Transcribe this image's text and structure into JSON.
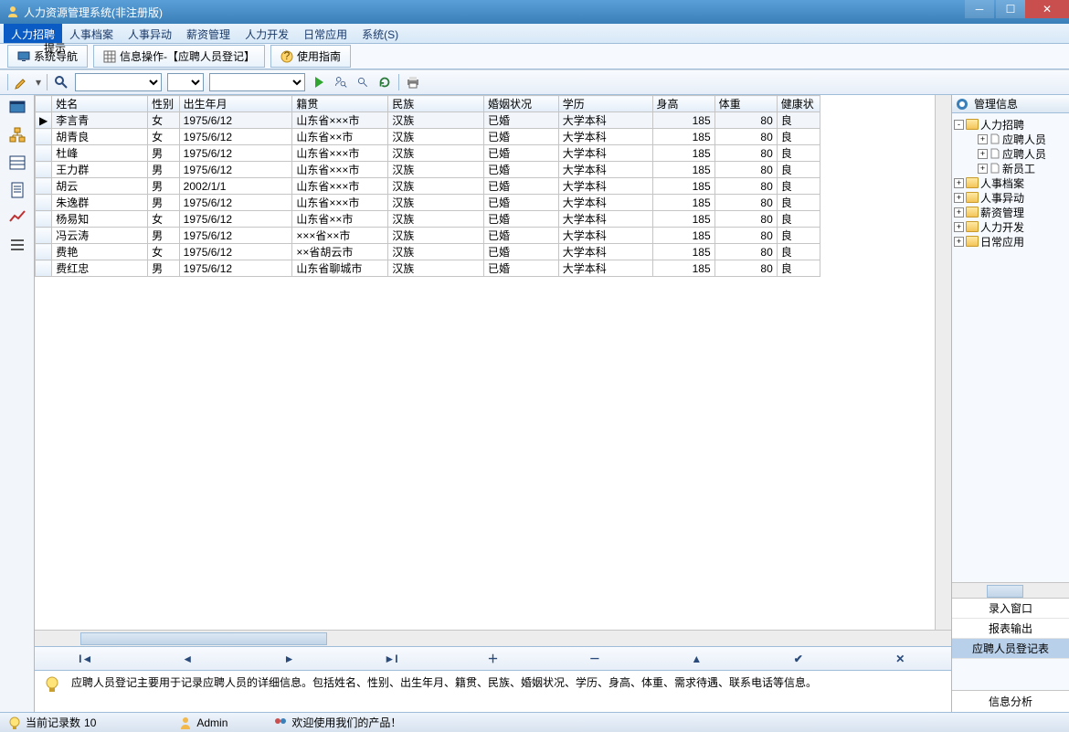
{
  "window": {
    "title": "人力资源管理系统(非注册版)"
  },
  "menus": [
    "人力招聘",
    "人事档案",
    "人事异动",
    "薪资管理",
    "人力开发",
    "日常应用",
    "系统(S)"
  ],
  "active_menu": 0,
  "tabs": {
    "nav": "系统导航",
    "info_op": "信息操作-【应聘人员登记】",
    "guide": "使用指南"
  },
  "grid": {
    "columns": [
      "姓名",
      "性别",
      "出生年月",
      "籍贯",
      "民族",
      "婚姻状况",
      "学历",
      "身高",
      "体重",
      "健康状"
    ],
    "rows": [
      {
        "name": "李言青",
        "sex": "女",
        "dob": "1975/6/12",
        "origin": "山东省×××市",
        "ethnic": "汉族",
        "marital": "已婚",
        "edu": "大学本科",
        "height": "185",
        "weight": "80",
        "health": "良"
      },
      {
        "name": "胡青良",
        "sex": "女",
        "dob": "1975/6/12",
        "origin": "山东省××市",
        "ethnic": "汉族",
        "marital": "已婚",
        "edu": "大学本科",
        "height": "185",
        "weight": "80",
        "health": "良"
      },
      {
        "name": "杜峰",
        "sex": "男",
        "dob": "1975/6/12",
        "origin": "山东省×××市",
        "ethnic": "汉族",
        "marital": "已婚",
        "edu": "大学本科",
        "height": "185",
        "weight": "80",
        "health": "良"
      },
      {
        "name": "王力群",
        "sex": "男",
        "dob": "1975/6/12",
        "origin": "山东省×××市",
        "ethnic": "汉族",
        "marital": "已婚",
        "edu": "大学本科",
        "height": "185",
        "weight": "80",
        "health": "良"
      },
      {
        "name": "胡云",
        "sex": "男",
        "dob": "2002/1/1",
        "origin": "山东省×××市",
        "ethnic": "汉族",
        "marital": "已婚",
        "edu": "大学本科",
        "height": "185",
        "weight": "80",
        "health": "良"
      },
      {
        "name": "朱逸群",
        "sex": "男",
        "dob": "1975/6/12",
        "origin": "山东省×××市",
        "ethnic": "汉族",
        "marital": "已婚",
        "edu": "大学本科",
        "height": "185",
        "weight": "80",
        "health": "良"
      },
      {
        "name": "杨易知",
        "sex": "女",
        "dob": "1975/6/12",
        "origin": "山东省××市",
        "ethnic": "汉族",
        "marital": "已婚",
        "edu": "大学本科",
        "height": "185",
        "weight": "80",
        "health": "良"
      },
      {
        "name": "冯云涛",
        "sex": "男",
        "dob": "1975/6/12",
        "origin": "×××省××市",
        "ethnic": "汉族",
        "marital": "已婚",
        "edu": "大学本科",
        "height": "185",
        "weight": "80",
        "health": "良"
      },
      {
        "name": "费艳",
        "sex": "女",
        "dob": "1975/6/12",
        "origin": "××省胡云市",
        "ethnic": "汉族",
        "marital": "已婚",
        "edu": "大学本科",
        "height": "185",
        "weight": "80",
        "health": "良"
      },
      {
        "name": "费红忠",
        "sex": "男",
        "dob": "1975/6/12",
        "origin": "山东省聊城市",
        "ethnic": "汉族",
        "marital": "已婚",
        "edu": "大学本科",
        "height": "185",
        "weight": "80",
        "health": "良"
      }
    ],
    "selected_row": 0
  },
  "hint": {
    "label": "提示",
    "text": "应聘人员登记主要用于记录应聘人员的详细信息。包括姓名、性别、出生年月、籍贯、民族、婚姻状况、学历、身高、体重、需求待遇、联系电话等信息。"
  },
  "rightpane": {
    "header": "管理信息",
    "tree": {
      "root": "人力招聘",
      "children": [
        "应聘人员",
        "应聘人员",
        "新员工"
      ],
      "siblings": [
        "人事档案",
        "人事异动",
        "薪资管理",
        "人力开发",
        "日常应用"
      ]
    },
    "list": [
      "录入窗口",
      "报表输出",
      "应聘人员登记表"
    ],
    "list_selected": 2,
    "footer": "信息分析"
  },
  "status": {
    "records_label": "当前记录数",
    "records_count": "10",
    "user": "Admin",
    "welcome": "欢迎使用我们的产品！"
  }
}
